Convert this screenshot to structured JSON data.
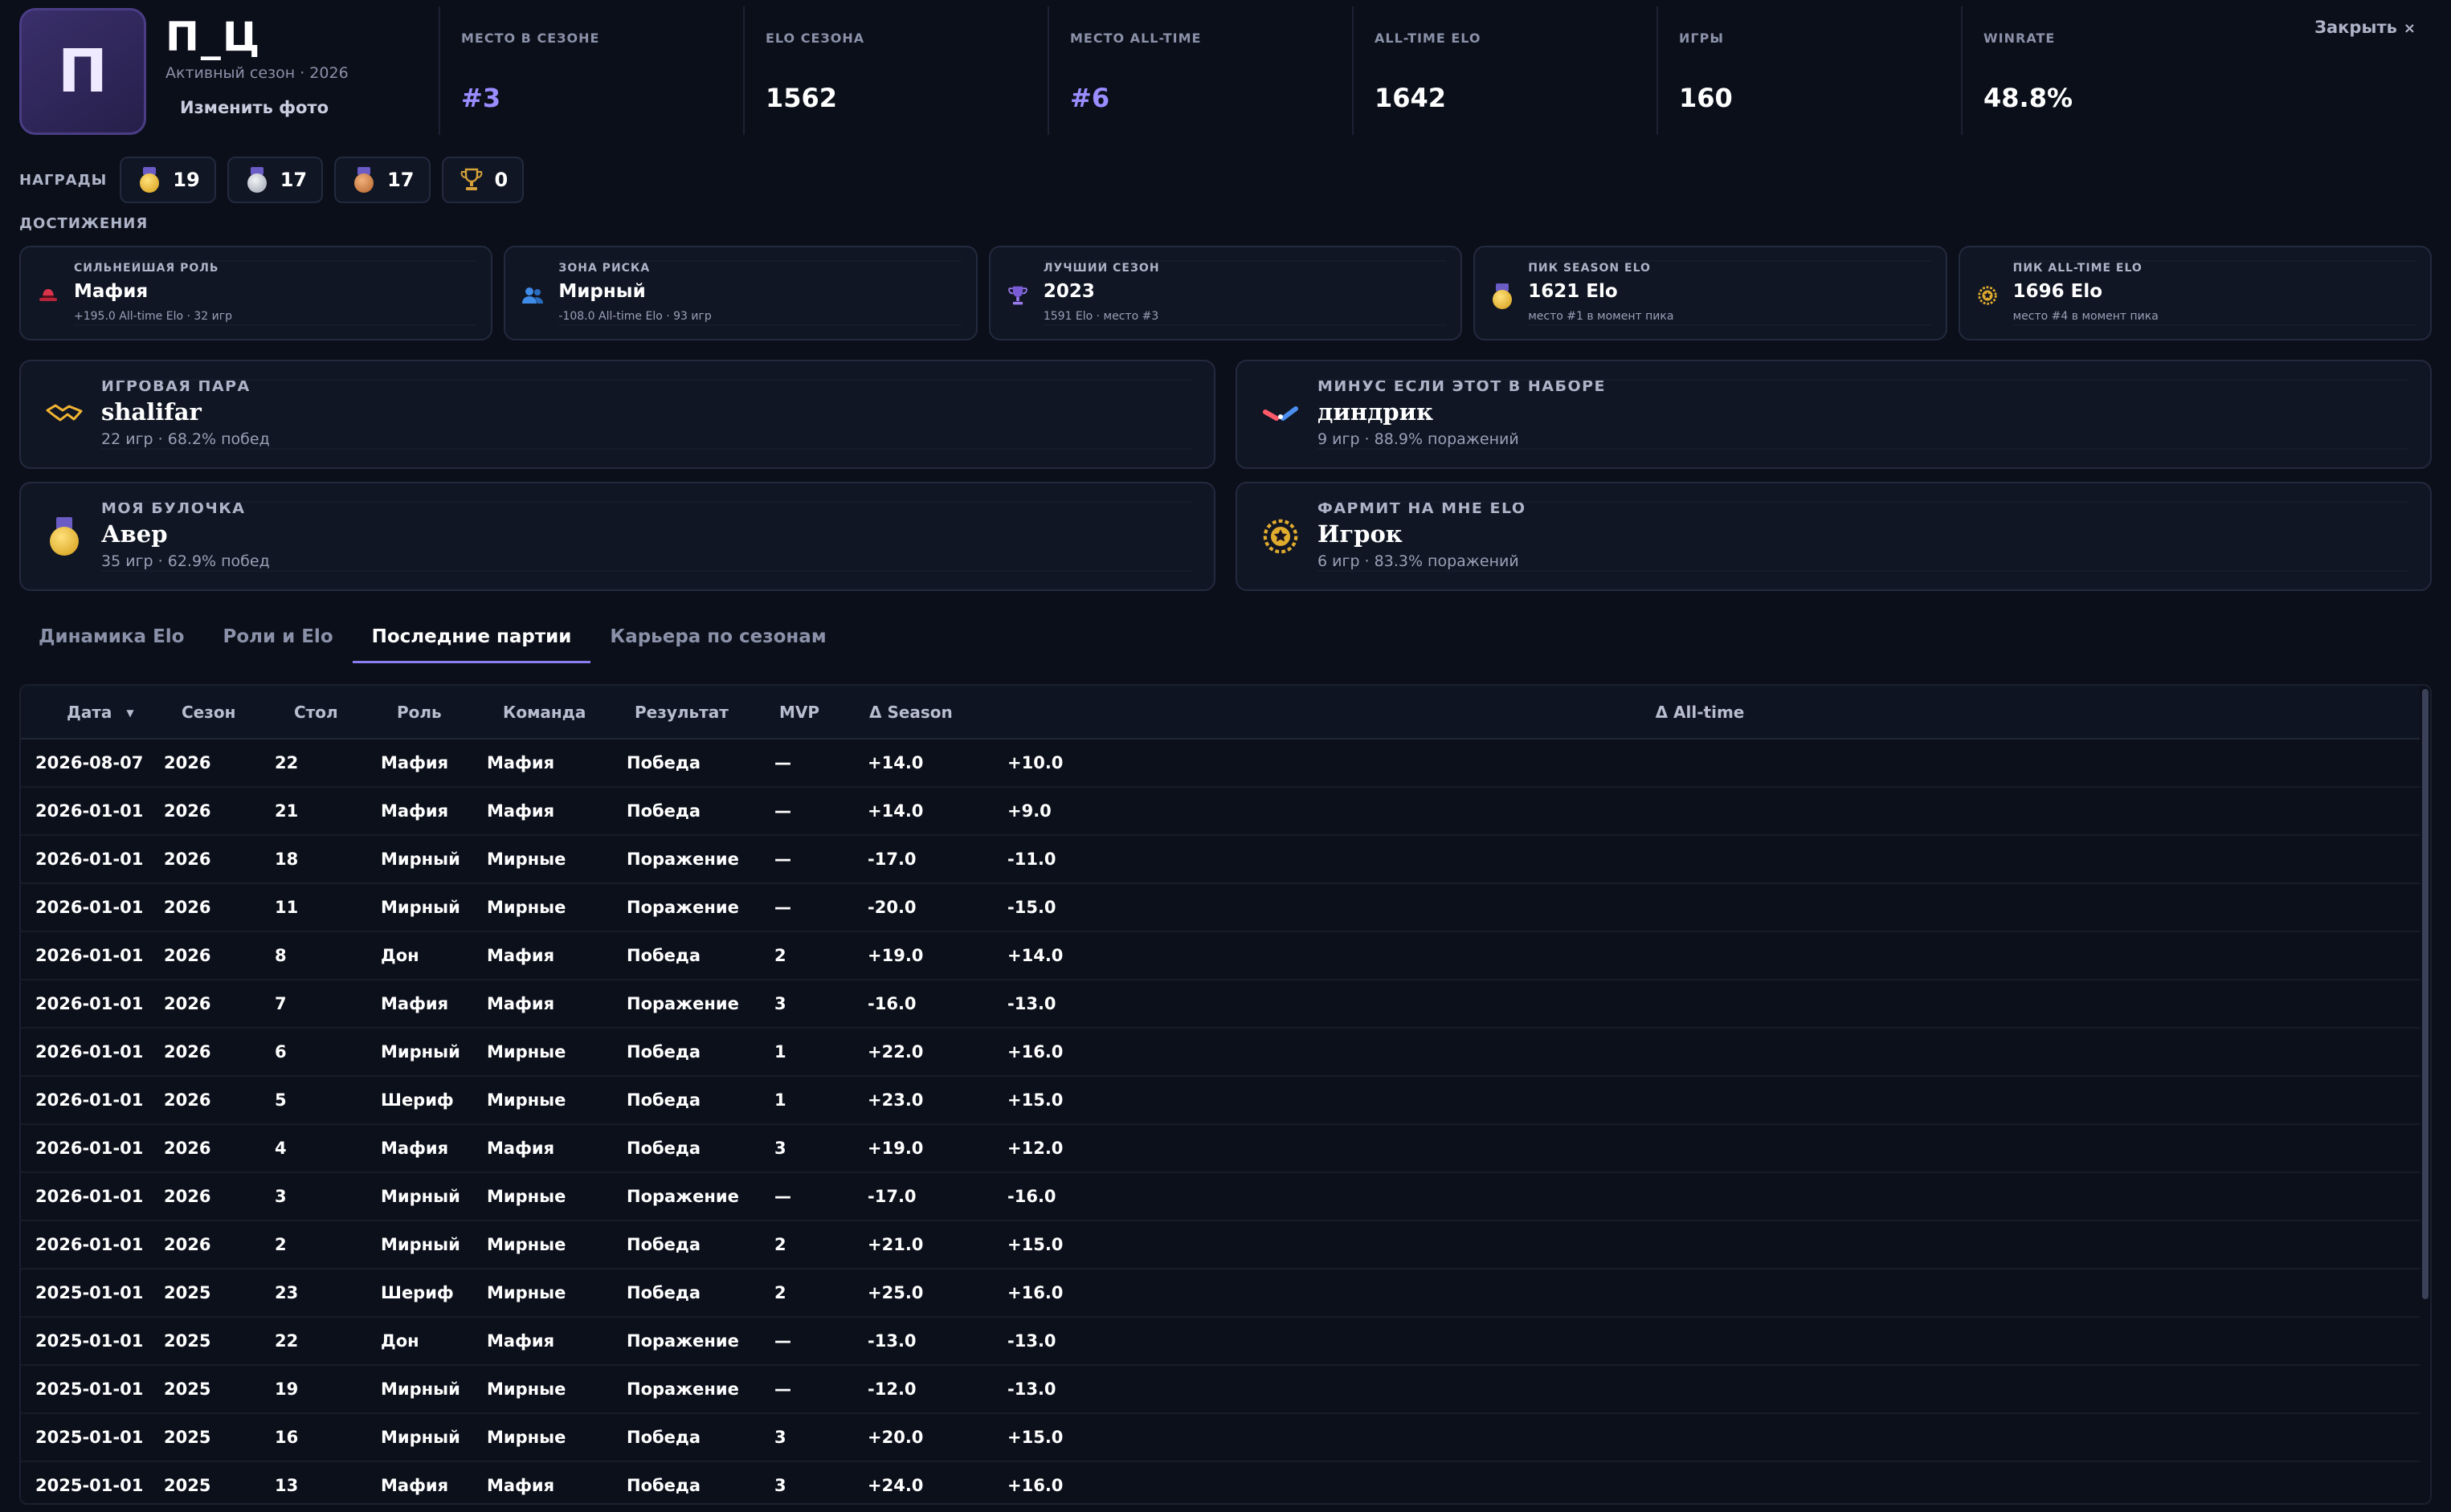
{
  "profile": {
    "avatar_letter": "П",
    "nickname": "П_Ц",
    "season_line": "Активный сезон · 2026",
    "change_photo": "Изменить фото"
  },
  "close_label": "Закрыть",
  "close_symbol": "×",
  "stats": [
    {
      "label": "МЕСТО В СЕЗОНЕ",
      "value": "#3"
    },
    {
      "label": "ELO СЕЗОНА",
      "value": "1562"
    },
    {
      "label": "МЕСТО ALL-TIME",
      "value": "#6"
    },
    {
      "label": "ALL-TIME ELO",
      "value": "1642"
    },
    {
      "label": "ИГРЫ",
      "value": "160"
    },
    {
      "label": "WINRATE",
      "value": "48.8%"
    }
  ],
  "awards": {
    "label": "НАГРАДЫ",
    "items": [
      {
        "icon": "gold-medal-icon",
        "count": "19"
      },
      {
        "icon": "silver-medal-icon",
        "count": "17"
      },
      {
        "icon": "bronze-medal-icon",
        "count": "17"
      },
      {
        "icon": "trophy-icon",
        "count": "0"
      }
    ]
  },
  "achievements": {
    "label": "ДОСТИЖЕНИЯ",
    "items": [
      {
        "icon": "fedora-hat-icon",
        "title": "СИЛЬНЕЙШАЯ РОЛЬ",
        "value": "Мафия",
        "sub": "+195.0 All-time Elo · 32 игр"
      },
      {
        "icon": "people-icon",
        "title": "ЗОНА РИСКА",
        "value": "Мирный",
        "sub": "-108.0 All-time Elo · 93 игр"
      },
      {
        "icon": "trophy-icon",
        "title": "ЛУЧШИЙ СЕЗОН",
        "value": "2023",
        "sub": "1591 Elo · место #3"
      },
      {
        "icon": "gold-medal-icon",
        "title": "ПИК SEASON ELO",
        "value": "1621 Elo",
        "sub": "место #1 в момент пика"
      },
      {
        "icon": "laurel-star-icon",
        "title": "ПИК ALL-TIME ELO",
        "value": "1696 Elo",
        "sub": "место #4 в момент пика"
      }
    ]
  },
  "relations": [
    {
      "icon": "handshake-icon",
      "title": "ИГРОВАЯ ПАРА",
      "name": "shalifar",
      "sub": "22 игр  ·  68.2% побед"
    },
    {
      "icon": "broken-link-icon",
      "title": "МИНУС ЕСЛИ ЭТОТ В НАБОРЕ",
      "name": "диндрик",
      "sub": "9 игр  ·  88.9% поражений"
    },
    {
      "icon": "gold-medal-icon",
      "title": "МОЯ БУЛОЧКА",
      "name": "Авер",
      "sub": "35 игр  ·  62.9% побед"
    },
    {
      "icon": "laurel-star-icon",
      "title": "ФАРМИТ НА МНЕ ELO",
      "name": "Игрок",
      "sub": "6 игр  ·  83.3% поражений"
    }
  ],
  "tabs": [
    {
      "label": "Динамика Elo",
      "active": false
    },
    {
      "label": "Роли и Elo",
      "active": false
    },
    {
      "label": "Последние партии",
      "active": true
    },
    {
      "label": "Карьера по сезонам",
      "active": false
    }
  ],
  "table": {
    "columns": [
      "Дата",
      "Сезон",
      "Стол",
      "Роль",
      "Команда",
      "Результат",
      "MVP",
      "Δ Season",
      "Δ All-time"
    ],
    "sort_indicator": "▼",
    "rows": [
      [
        "2026-08-07",
        "2026",
        "22",
        "Мафия",
        "Мафия",
        "Победа",
        "—",
        "+14.0",
        "+10.0"
      ],
      [
        "2026-01-01",
        "2026",
        "21",
        "Мафия",
        "Мафия",
        "Победа",
        "—",
        "+14.0",
        "+9.0"
      ],
      [
        "2026-01-01",
        "2026",
        "18",
        "Мирный",
        "Мирные",
        "Поражение",
        "—",
        "-17.0",
        "-11.0"
      ],
      [
        "2026-01-01",
        "2026",
        "11",
        "Мирный",
        "Мирные",
        "Поражение",
        "—",
        "-20.0",
        "-15.0"
      ],
      [
        "2026-01-01",
        "2026",
        "8",
        "Дон",
        "Мафия",
        "Победа",
        "2",
        "+19.0",
        "+14.0"
      ],
      [
        "2026-01-01",
        "2026",
        "7",
        "Мафия",
        "Мафия",
        "Поражение",
        "3",
        "-16.0",
        "-13.0"
      ],
      [
        "2026-01-01",
        "2026",
        "6",
        "Мирный",
        "Мирные",
        "Победа",
        "1",
        "+22.0",
        "+16.0"
      ],
      [
        "2026-01-01",
        "2026",
        "5",
        "Шериф",
        "Мирные",
        "Победа",
        "1",
        "+23.0",
        "+15.0"
      ],
      [
        "2026-01-01",
        "2026",
        "4",
        "Мафия",
        "Мафия",
        "Победа",
        "3",
        "+19.0",
        "+12.0"
      ],
      [
        "2026-01-01",
        "2026",
        "3",
        "Мирный",
        "Мирные",
        "Поражение",
        "—",
        "-17.0",
        "-16.0"
      ],
      [
        "2026-01-01",
        "2026",
        "2",
        "Мирный",
        "Мирные",
        "Победа",
        "2",
        "+21.0",
        "+15.0"
      ],
      [
        "2025-01-01",
        "2025",
        "23",
        "Шериф",
        "Мирные",
        "Победа",
        "2",
        "+25.0",
        "+16.0"
      ],
      [
        "2025-01-01",
        "2025",
        "22",
        "Дон",
        "Мафия",
        "Поражение",
        "—",
        "-13.0",
        "-13.0"
      ],
      [
        "2025-01-01",
        "2025",
        "19",
        "Мирный",
        "Мирные",
        "Поражение",
        "—",
        "-12.0",
        "-13.0"
      ],
      [
        "2025-01-01",
        "2025",
        "16",
        "Мирный",
        "Мирные",
        "Победа",
        "3",
        "+20.0",
        "+15.0"
      ],
      [
        "2025-01-01",
        "2025",
        "13",
        "Мафия",
        "Мафия",
        "Победа",
        "3",
        "+24.0",
        "+16.0"
      ]
    ]
  },
  "colors": {
    "background": "#0b0f1a",
    "accent": "#9b8cff",
    "card": "#111624"
  }
}
